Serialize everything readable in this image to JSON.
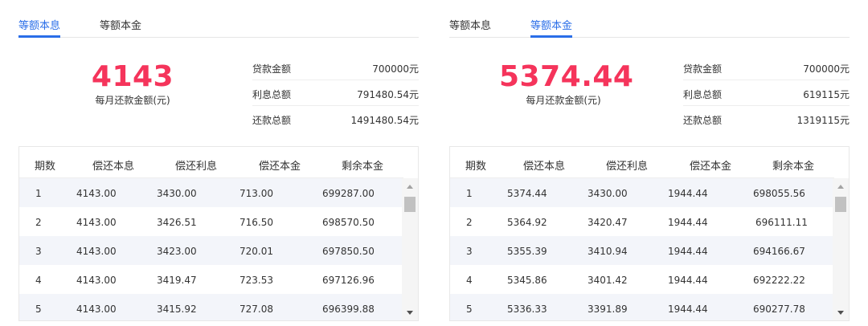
{
  "panels": [
    {
      "tabs": [
        {
          "label": "等额本息",
          "active": true
        },
        {
          "label": "等额本金",
          "active": false
        }
      ],
      "monthly_amount": "4143",
      "monthly_caption": "每月还款金额(元)",
      "summary": [
        {
          "label": "贷款金额",
          "value": "700000元"
        },
        {
          "label": "利息总额",
          "value": "791480.54元"
        },
        {
          "label": "还款总额",
          "value": "1491480.54元"
        }
      ],
      "table": {
        "headers": [
          "期数",
          "偿还本息",
          "偿还利息",
          "偿还本金",
          "剩余本金"
        ],
        "rows": [
          [
            "1",
            "4143.00",
            "3430.00",
            "713.00",
            "699287.00"
          ],
          [
            "2",
            "4143.00",
            "3426.51",
            "716.50",
            "698570.50"
          ],
          [
            "3",
            "4143.00",
            "3423.00",
            "720.01",
            "697850.50"
          ],
          [
            "4",
            "4143.00",
            "3419.47",
            "723.53",
            "697126.96"
          ],
          [
            "5",
            "4143.00",
            "3415.92",
            "727.08",
            "696399.88"
          ]
        ]
      }
    },
    {
      "tabs": [
        {
          "label": "等额本息",
          "active": false
        },
        {
          "label": "等额本金",
          "active": true
        }
      ],
      "monthly_amount": "5374.44",
      "monthly_caption": "每月还款金额(元)",
      "summary": [
        {
          "label": "贷款金额",
          "value": "700000元"
        },
        {
          "label": "利息总额",
          "value": "619115元"
        },
        {
          "label": "还款总额",
          "value": "1319115元"
        }
      ],
      "table": {
        "headers": [
          "期数",
          "偿还本息",
          "偿还利息",
          "偿还本金",
          "剩余本金"
        ],
        "rows": [
          [
            "1",
            "5374.44",
            "3430.00",
            "1944.44",
            "698055.56"
          ],
          [
            "2",
            "5364.92",
            "3420.47",
            "1944.44",
            "696111.11"
          ],
          [
            "3",
            "5355.39",
            "3410.94",
            "1944.44",
            "694166.67"
          ],
          [
            "4",
            "5345.86",
            "3401.42",
            "1944.44",
            "692222.22"
          ],
          [
            "5",
            "5336.33",
            "3391.89",
            "1944.44",
            "690277.78"
          ]
        ]
      }
    }
  ],
  "colors": {
    "accent": "#2a6ee8",
    "amount": "#f5345b",
    "row_stripe": "#f3f5fa"
  }
}
